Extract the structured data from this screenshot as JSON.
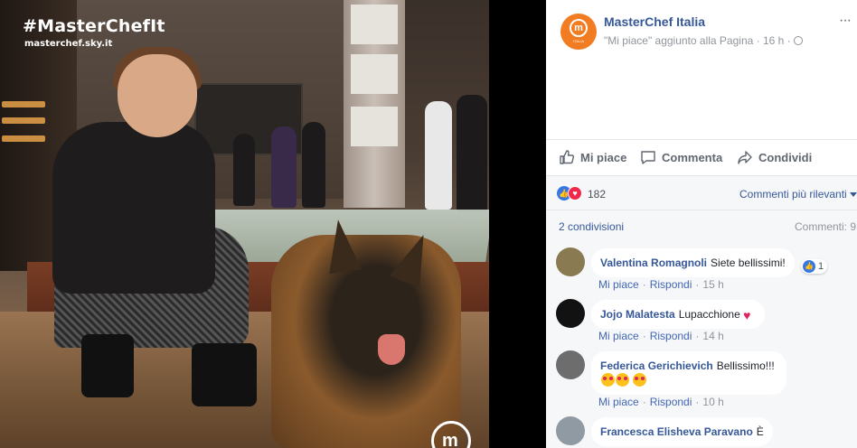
{
  "photo": {
    "hashtag": "#MasterChefIt",
    "url": "masterchef.sky.it",
    "logo_letter": "m"
  },
  "post": {
    "page_name": "MasterChef Italia",
    "avatar_letter": "m",
    "avatar_subtitle": "ITALIA",
    "meta": "\"Mi piace\" aggiunto alla Pagina · 16 h ·",
    "more_label": "···"
  },
  "actions": {
    "like": "Mi piace",
    "comment": "Commenta",
    "share": "Condividi"
  },
  "reactions": {
    "count": "182",
    "sort_label": "Commenti più rilevanti"
  },
  "stats": {
    "shares": "2 condivisioni",
    "comments": "Commenti: 9"
  },
  "comments": [
    {
      "author": "Valentina Romagnoli",
      "text": "Siete bellissimi!",
      "like": "Mi piace",
      "reply": "Rispondi",
      "time": "15 h",
      "like_count": "1",
      "avatar_color": "#8a7a52"
    },
    {
      "author": "Jojo Malatesta",
      "text": "Lupacchione",
      "like": "Mi piace",
      "reply": "Rispondi",
      "time": "14 h",
      "avatar_color": "#121212"
    },
    {
      "author": "Federica Gerichievich",
      "text": "Bellissimo!!!",
      "like": "Mi piace",
      "reply": "Rispondi",
      "time": "10 h",
      "avatar_color": "#6d6d6d"
    },
    {
      "author": "Francesca Elisheva Paravano",
      "text": "È",
      "avatar_color": "#8f9aa3"
    }
  ]
}
